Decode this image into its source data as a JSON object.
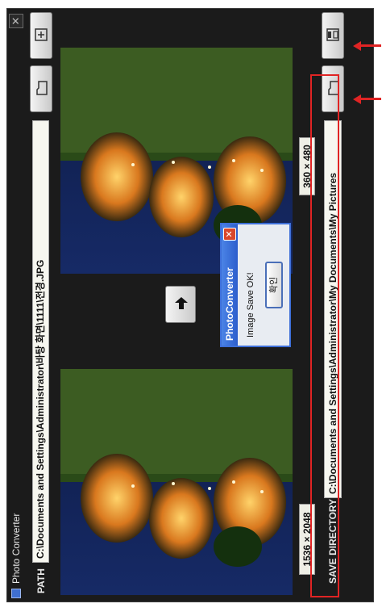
{
  "window": {
    "title": "Photo Converter",
    "close_glyph": "✕"
  },
  "path": {
    "label": "PATH",
    "value": "C:\\Documents and Settings\\Administrator\\바탕 화면\\1111\\전경.JPG"
  },
  "source_image": {
    "size": "1536 × 2048"
  },
  "result_image": {
    "size": "360 × 480"
  },
  "save": {
    "label": "SAVE DIRECTORY",
    "value": "C:\\Documents and Settings\\Administrator\\My Documents\\My Pictures"
  },
  "dialog": {
    "title": "PhotoConverter",
    "message": "Image Save OK!",
    "ok_label": "확인",
    "close_glyph": "✕"
  },
  "icons": {
    "open": "folder-icon",
    "new": "new-image-icon",
    "convert": "arrow-icon",
    "save": "save-icon"
  },
  "colors": {
    "highlight": "#e02424",
    "dialog_title": "#2c5dcc",
    "window_bg": "#1b1b1b"
  }
}
